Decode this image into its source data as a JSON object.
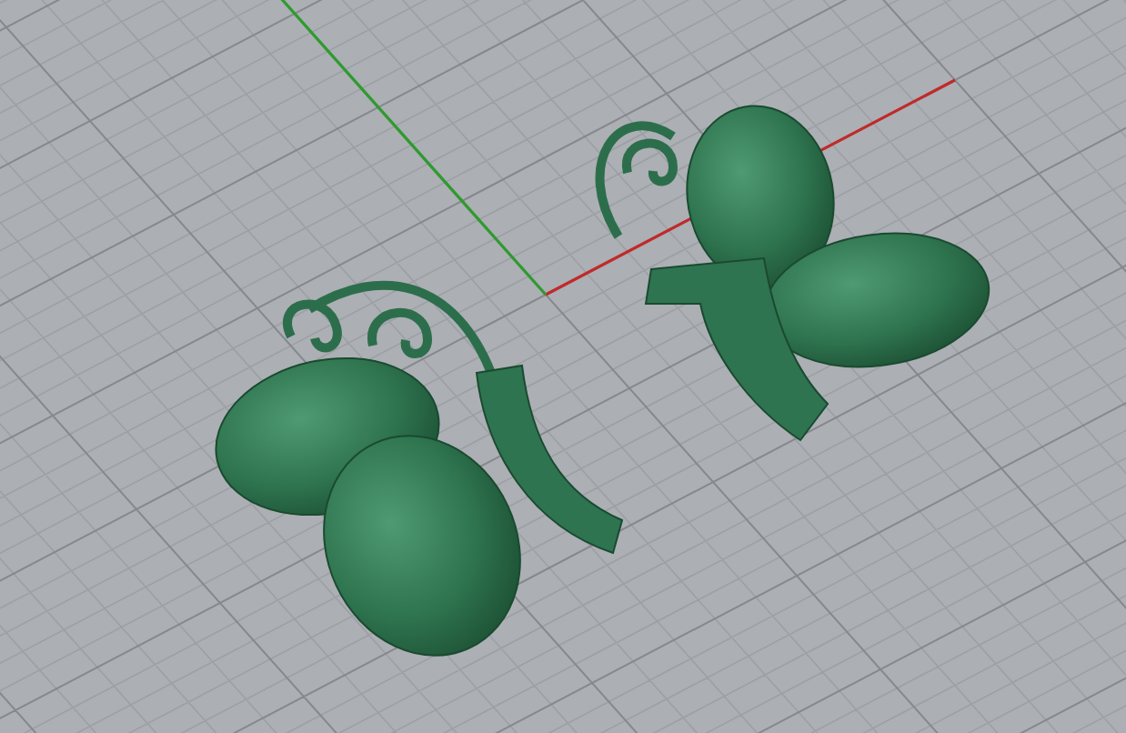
{
  "viewport": {
    "show_grid": true,
    "show_axes": true
  }
}
